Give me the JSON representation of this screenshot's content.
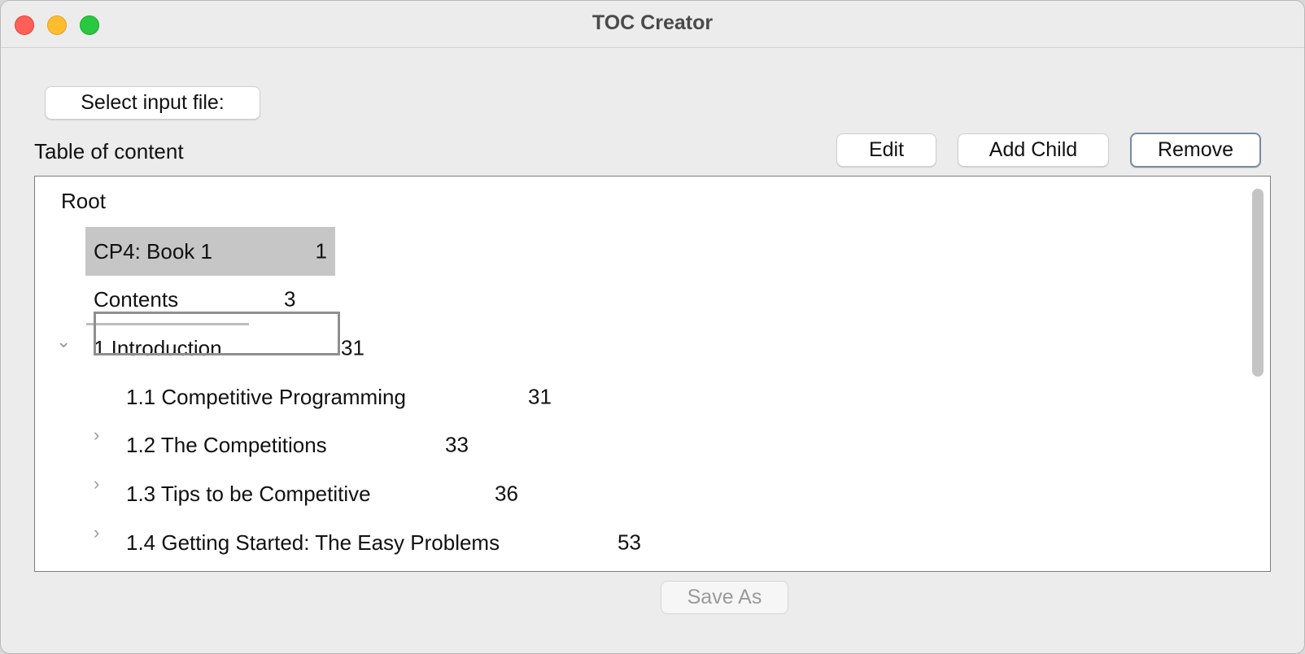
{
  "window": {
    "title": "TOC Creator"
  },
  "toolbar": {
    "select_input_label": "Select input file:",
    "edit_label": "Edit",
    "add_child_label": "Add Child",
    "remove_label": "Remove",
    "save_as_label": "Save As"
  },
  "toc": {
    "label": "Table of content",
    "root": "Root",
    "items": [
      {
        "title": "CP4: Book 1",
        "page": "1",
        "selected": true
      },
      {
        "title": "Contents",
        "page": "3"
      },
      {
        "title": "1 Introduction",
        "page": "31",
        "expanded": true,
        "editing": true
      },
      {
        "title": "1.1 Competitive Programming",
        "page": "31"
      },
      {
        "title": "1.2 The Competitions",
        "page": "33",
        "collapsed": true
      },
      {
        "title": "1.3 Tips to be Competitive",
        "page": "36",
        "collapsed": true
      },
      {
        "title": "1.4 Getting Started: The Easy Problems",
        "page": "53",
        "collapsed": true
      }
    ]
  },
  "icons": {
    "close": "close-icon",
    "minimize": "minimize-icon",
    "maximize": "maximize-icon",
    "expanded": "chevron-down-icon",
    "collapsed": "chevron-right-icon"
  }
}
